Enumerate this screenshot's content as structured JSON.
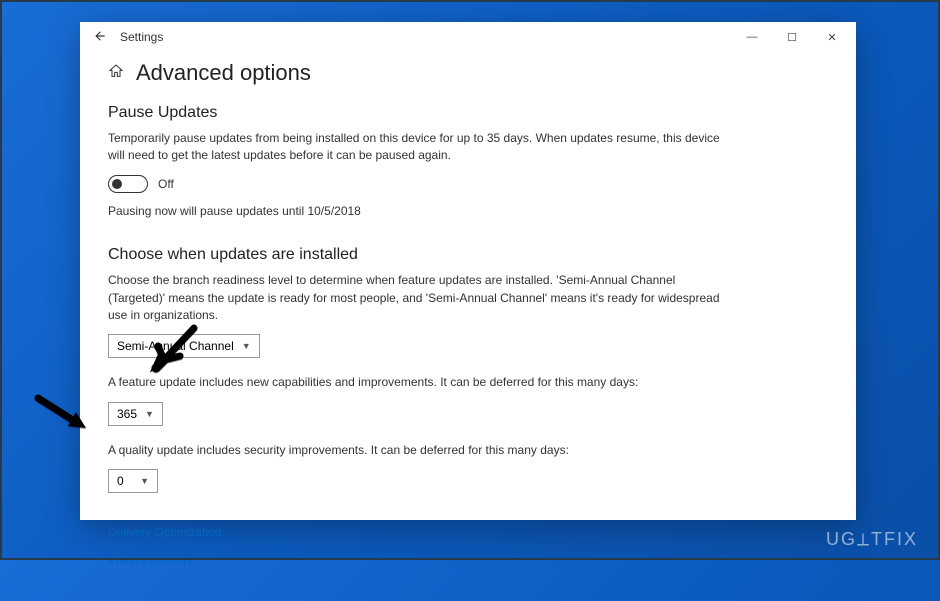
{
  "titlebar": {
    "app": "Settings"
  },
  "page": {
    "title": "Advanced options"
  },
  "pause": {
    "heading": "Pause Updates",
    "desc": "Temporarily pause updates from being installed on this device for up to 35 days. When updates resume, this device will need to get the latest updates before it can be paused again.",
    "toggle_label": "Off",
    "status": "Pausing now will pause updates until 10/5/2018"
  },
  "choose": {
    "heading": "Choose when updates are installed",
    "desc": "Choose the branch readiness level to determine when feature updates are installed. 'Semi-Annual Channel (Targeted)' means the update is ready for most people, and 'Semi-Annual Channel' means it's ready for widespread use in organizations.",
    "branch_value": "Semi-Annual Channel",
    "feature_desc": "A feature update includes new capabilities and improvements. It can be deferred for this many days:",
    "feature_value": "365",
    "quality_desc": "A quality update includes security improvements. It can be deferred for this many days:",
    "quality_value": "0"
  },
  "links": {
    "delivery": "Delivery Optimization",
    "privacy": "Privacy settings"
  },
  "watermark": "UG⟂TFIX"
}
